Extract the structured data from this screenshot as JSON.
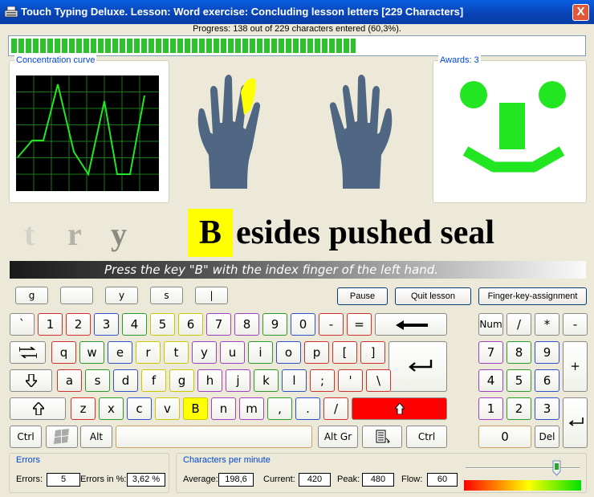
{
  "window": {
    "title": "Touch Typing Deluxe. Lesson: Word exercise: Concluding lesson letters [229 Characters]",
    "close_label": "X"
  },
  "progress": {
    "label": "Progress: 138 out of 229 characters entered (60,3%).",
    "entered": 138,
    "total": 229,
    "fraction": 0.603
  },
  "concentration": {
    "label": "Concentration curve",
    "curve_values": [
      0.3,
      0.45,
      0.45,
      0.95,
      0.35,
      0.15,
      0.8,
      0.15,
      0.15,
      0.85
    ]
  },
  "awards": {
    "label": "Awards: 3",
    "count": 3
  },
  "hands": {
    "highlight_finger": "left-index"
  },
  "typing": {
    "done_letters": [
      "t",
      "r",
      "y"
    ],
    "current_letter": "B",
    "remaining_text": "esides pushed seal",
    "instruction": "Press the key \"B\" with the index finger of the left hand."
  },
  "preview_keys": [
    "g",
    "",
    "y",
    "s",
    "|"
  ],
  "controls": {
    "pause": "Pause",
    "quit": "Quit lesson",
    "assignment": "Finger-key-assignment"
  },
  "keyboard": {
    "row1": [
      "`",
      "1",
      "2",
      "3",
      "4",
      "5",
      "6",
      "7",
      "8",
      "9",
      "0",
      "-",
      "="
    ],
    "row2": [
      "q",
      "w",
      "e",
      "r",
      "t",
      "y",
      "u",
      "i",
      "o",
      "p",
      "[",
      "]"
    ],
    "row3": [
      "a",
      "s",
      "d",
      "f",
      "g",
      "h",
      "j",
      "k",
      "l",
      ";",
      "'",
      "\\"
    ],
    "row4": [
      "z",
      "x",
      "c",
      "v",
      "B",
      "n",
      "m",
      ",",
      ".",
      "/"
    ],
    "ctrl": "Ctrl",
    "alt": "Alt",
    "altgr": "Alt Gr",
    "backspace_icon": "arrow-left-icon",
    "tab_icon": "tab-arrows-icon",
    "enter_icon": "return-arrow-icon",
    "caps_icon": "arrow-down-icon",
    "shift_icon": "arrow-up-icon",
    "highlight_key": "B",
    "highlight_color": "#ffff00",
    "active_shift_color": "#ff0000"
  },
  "numpad": {
    "num": "Num",
    "div": "/",
    "mul": "*",
    "minus": "-",
    "plus": "+",
    "k7": "7",
    "k8": "8",
    "k9": "9",
    "k4": "4",
    "k5": "5",
    "k6": "6",
    "k1": "1",
    "k2": "2",
    "k3": "3",
    "k0": "0",
    "del": "Del"
  },
  "errors": {
    "label": "Errors",
    "count_label": "Errors:",
    "count": "5",
    "percent_label": "Errors in %:",
    "percent": "3,62 %"
  },
  "cpm": {
    "label": "Characters per minute",
    "average_label": "Average:",
    "average": "198,6",
    "current_label": "Current:",
    "current": "420",
    "peak_label": "Peak:",
    "peak": "480",
    "flow_label": "Flow:",
    "flow": "60"
  },
  "speed_slider": {
    "level": 0.8
  }
}
